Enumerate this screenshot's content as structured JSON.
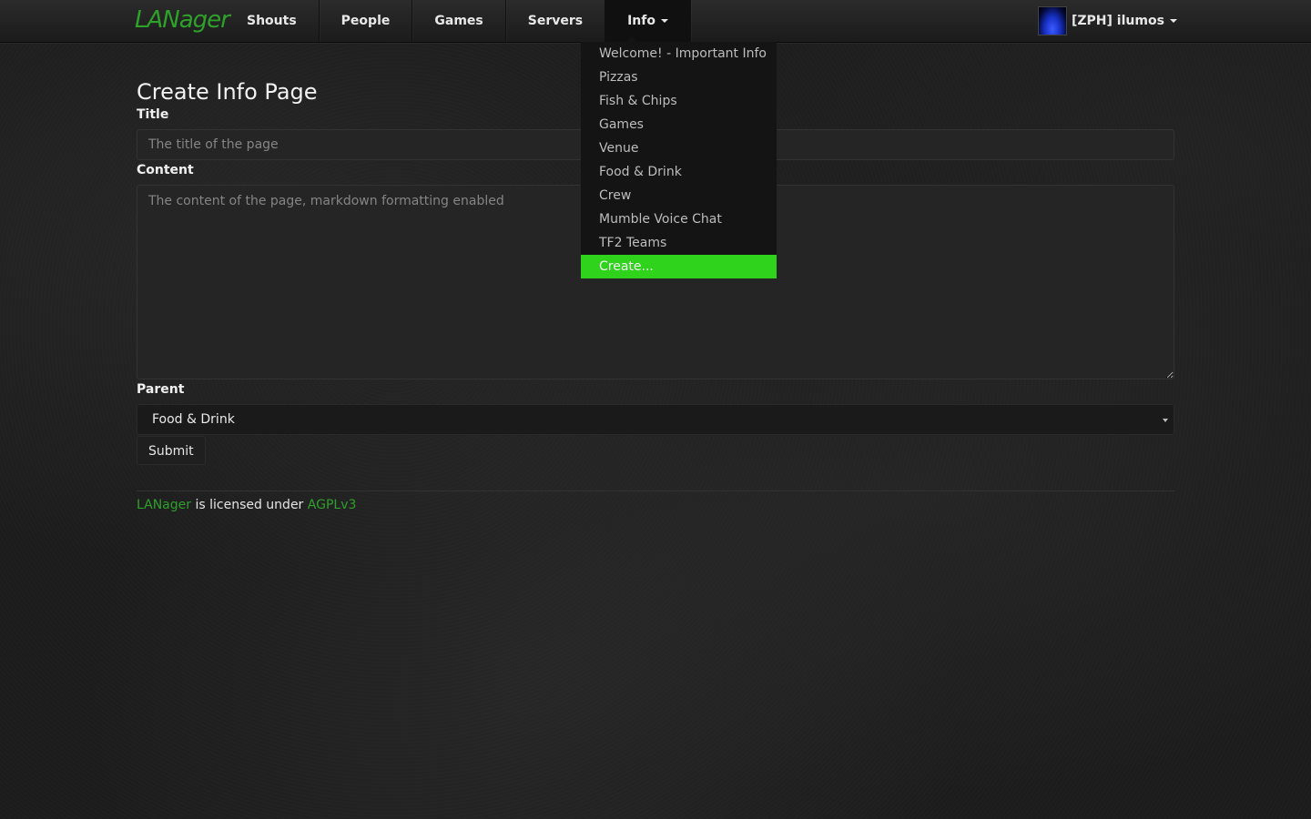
{
  "navbar": {
    "brand": "LANager",
    "items": [
      {
        "label": "Shouts"
      },
      {
        "label": "People"
      },
      {
        "label": "Games"
      },
      {
        "label": "Servers"
      },
      {
        "label": "Info"
      }
    ],
    "user": "[ZPH] ilumos"
  },
  "dropdown": {
    "items": [
      {
        "label": "Welcome! - Important Info"
      },
      {
        "label": "Pizzas"
      },
      {
        "label": "Fish & Chips"
      },
      {
        "label": "Games"
      },
      {
        "label": "Venue"
      },
      {
        "label": "Food & Drink"
      },
      {
        "label": "Crew"
      },
      {
        "label": "Mumble Voice Chat"
      },
      {
        "label": "TF2 Teams"
      },
      {
        "label": "Create..."
      }
    ]
  },
  "form": {
    "heading": "Create Info Page",
    "title_label": "Title",
    "title_placeholder": "The title of the page",
    "content_label": "Content",
    "content_placeholder": "The content of the page, markdown formatting enabled",
    "parent_label": "Parent",
    "parent_value": "Food & Drink",
    "submit_label": "Submit"
  },
  "footer": {
    "project_link": "LANager",
    "text": " is licensed under ",
    "license_link": "AGPLv3"
  },
  "colors": {
    "accent": "#2fd31c",
    "link": "#2fa02a"
  }
}
